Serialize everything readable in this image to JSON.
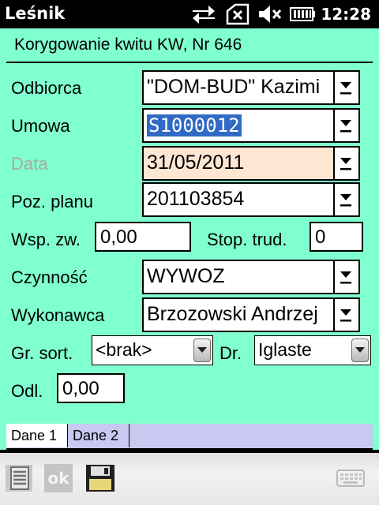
{
  "status_bar": {
    "app_title": "Leśnik",
    "time": "12:28",
    "icons": [
      "data-transfer-icon",
      "no-signal-icon",
      "speaker-muted-icon",
      "battery-icon"
    ]
  },
  "form": {
    "title": "Korygowanie kwitu KW, Nr 646",
    "fields": {
      "odbiorca": {
        "label": "Odbiorca",
        "value": "\"DOM-BUD\" Kazimi"
      },
      "umowa": {
        "label": "Umowa",
        "value": "S1000012"
      },
      "data": {
        "label": "Data",
        "value": "31/05/2011"
      },
      "poz_planu": {
        "label": "Poz. planu",
        "value": "201103854"
      },
      "wsp_zw": {
        "label": "Wsp. zw.",
        "value": "0,00"
      },
      "stop_trud": {
        "label": "Stop. trud.",
        "value": "0"
      },
      "czynnosc": {
        "label": "Czynność",
        "value": "WYWOZ"
      },
      "wykonawca": {
        "label": "Wykonawca",
        "value": "Brzozowski Andrzej"
      },
      "gr_sort": {
        "label": "Gr. sort.",
        "value": "<brak>"
      },
      "dr": {
        "label": "Dr.",
        "value": "Iglaste"
      },
      "odl": {
        "label": "Odl.",
        "value": "0,00"
      }
    },
    "tabs": [
      {
        "label": "Dane 1",
        "active": true
      },
      {
        "label": "Dane 2",
        "active": false
      }
    ]
  },
  "menu_bar": {
    "ok_label": "ok",
    "icons": [
      "document-list-icon",
      "save-floppy-icon",
      "keyboard-icon"
    ]
  },
  "colors": {
    "form_background": "#80ffcf",
    "selection": "#316ac5",
    "date_field": "#fde6d2",
    "tab_bar": "#c8c8f0"
  }
}
